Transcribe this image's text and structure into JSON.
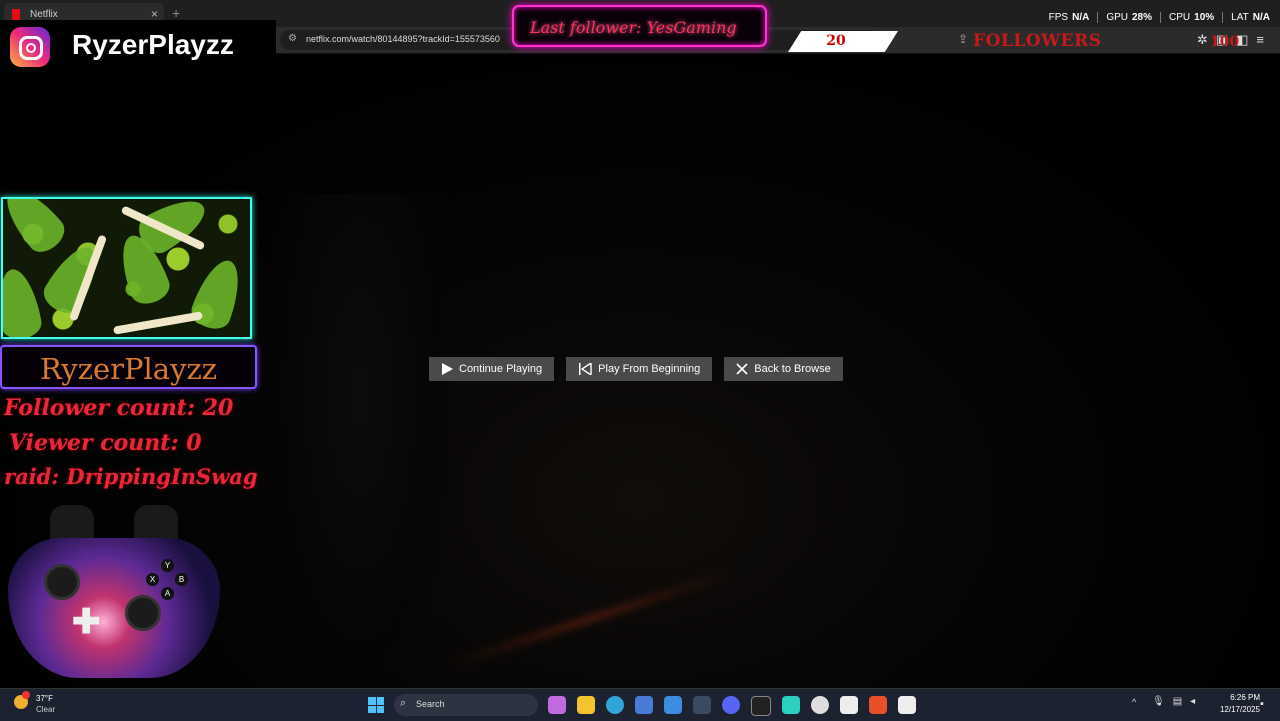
{
  "browser": {
    "tab_title": "Netflix",
    "url": "netflix.com/watch/80144895?trackId=155573560"
  },
  "perf": [
    {
      "label": "FPS",
      "value": "N/A"
    },
    {
      "label": "GPU",
      "value": "28%"
    },
    {
      "label": "CPU",
      "value": "10%"
    },
    {
      "label": "LAT",
      "value": "N/A"
    }
  ],
  "overlay": {
    "instagram_handle": "RyzerPlayzz",
    "last_follower": "Last follower: YesGaming",
    "follower_goal_current": "20",
    "follower_goal_label": "FOLLOWERS",
    "follower_goal_target": "100",
    "channel_name": "RyzerPlayzz",
    "follower_count": "Follower count: 20",
    "viewer_count": "Viewer count: 0",
    "raid": "raid: DrippingInSwag",
    "controller_buttons": {
      "y": "Y",
      "x": "X",
      "b": "B",
      "a": "A"
    }
  },
  "player": {
    "continue_label": "Continue Playing",
    "restart_label": "Play From Beginning",
    "back_label": "Back to Browse"
  },
  "taskbar": {
    "weather_temp": "37°F",
    "weather_condition": "Clear",
    "search_label": "Search",
    "time": "6:26 PM",
    "date": "12/17/2025",
    "apps": [
      "widgets-icon",
      "copilot-icon",
      "file-explorer-icon",
      "edge-icon",
      "store-icon",
      "app-icon",
      "steam-icon",
      "discord-icon",
      "epic-games-icon",
      "xbox-icon",
      "settings-icon",
      "app-s-icon",
      "brave-icon",
      "app-s2-icon"
    ]
  },
  "colors": {
    "neon_pink": "#ff33cc",
    "neon_cyan": "#44ffee",
    "neon_purple": "#8a55ff",
    "overlay_red": "#e8283a",
    "button_gray": "#4a4a4a"
  }
}
